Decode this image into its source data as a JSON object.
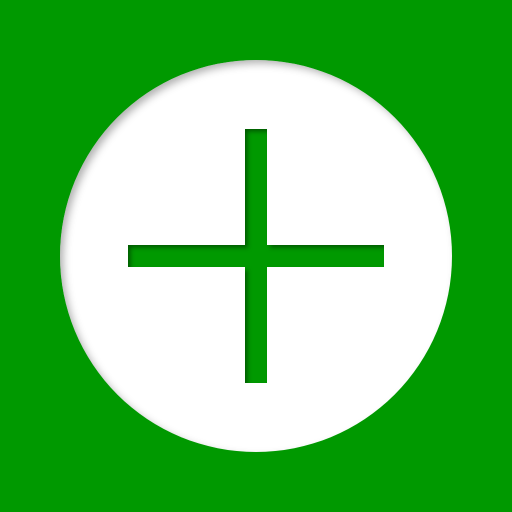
{
  "icon": {
    "name": "add-icon",
    "glyph": "plus",
    "colors": {
      "background": "#009900",
      "circle": "#ffffff",
      "plus": "#009900"
    }
  }
}
